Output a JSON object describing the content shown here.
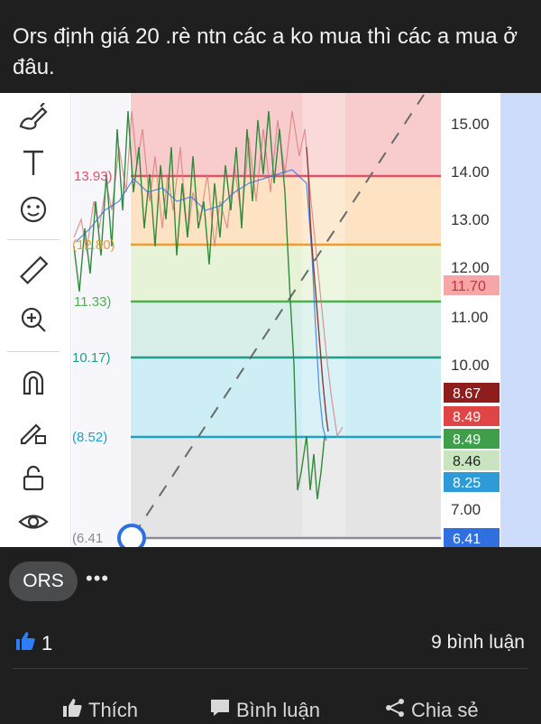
{
  "post": {
    "text": "Ors định giá 20 .rè ntn các a ko mua thì các a mua ở đâu."
  },
  "toolbar": {
    "icons": [
      "brush-icon",
      "text-icon",
      "emoji-icon",
      "ruler-icon",
      "zoom-in-icon",
      "magnet-icon",
      "pencil-lock-icon",
      "unlock-icon",
      "eye-icon"
    ]
  },
  "chart": {
    "price_axis": [
      "15.00",
      "14.00",
      "13.00",
      "12.00",
      "11.00",
      "10.00",
      "7.00"
    ],
    "fib_labels": [
      {
        "text": "13.93)",
        "color": "#e0506a"
      },
      {
        "text": "(12.80)",
        "color": "#f19b2c"
      },
      {
        "text": "11.33)",
        "color": "#4caf50"
      },
      {
        "text": "10.17)",
        "color": "#1f9e8c"
      },
      {
        "text": "(8.52)",
        "color": "#1aa3c7"
      },
      {
        "text": "(6.41",
        "color": "#8a8a8a"
      }
    ],
    "price_tags": [
      {
        "text": "11.70",
        "bg": "#f6a6a6",
        "fg": "#c03535"
      },
      {
        "text": "8.67",
        "bg": "#8e1e1e",
        "fg": "#ffffff"
      },
      {
        "text": "8.49",
        "bg": "#e04545",
        "fg": "#ffffff"
      },
      {
        "text": "8.49",
        "bg": "#3f9e4a",
        "fg": "#ffffff"
      },
      {
        "text": "8.46",
        "bg": "#c9e5c0",
        "fg": "#222222"
      },
      {
        "text": "8.25",
        "bg": "#2e9bd8",
        "fg": "#ffffff"
      },
      {
        "text": "6.41",
        "bg": "#2f6fe0",
        "fg": "#ffffff"
      }
    ]
  },
  "tag": {
    "label": "ORS",
    "more": "•••"
  },
  "stats": {
    "likes": "1",
    "comments": "9 bình luận"
  },
  "actions": {
    "like": "Thích",
    "comment": "Bình luận",
    "share": "Chia sẻ"
  },
  "colors": {
    "accent_blue": "#2d7ff9",
    "background": "#1f1f20"
  }
}
